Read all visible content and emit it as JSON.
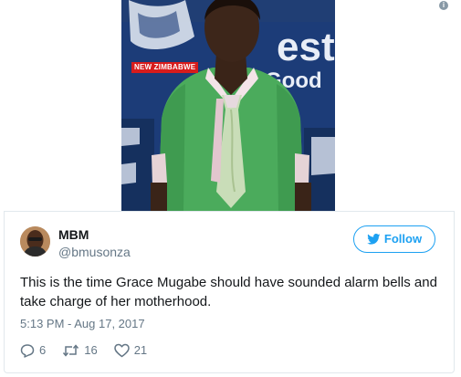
{
  "photo": {
    "watermark": "NEW ZIMBABWE",
    "backdrop_text": [
      "est",
      "Good"
    ]
  },
  "tweet": {
    "display_name": "MBM",
    "handle": "@bmusonza",
    "follow_label": "Follow",
    "text": "This is the time Grace Mugabe should have sounded alarm bells and take charge of her motherhood.",
    "timestamp": "5:13 PM - Aug 17, 2017",
    "replies": "6",
    "retweets": "16",
    "likes": "21"
  },
  "icons": {
    "info": "info-icon",
    "follow": "twitter-bird-icon",
    "reply": "reply-icon",
    "retweet": "retweet-icon",
    "like": "heart-icon"
  },
  "colors": {
    "accent": "#1da1f2",
    "text": "#14171a",
    "muted": "#657786",
    "border": "#e1e8ed"
  }
}
